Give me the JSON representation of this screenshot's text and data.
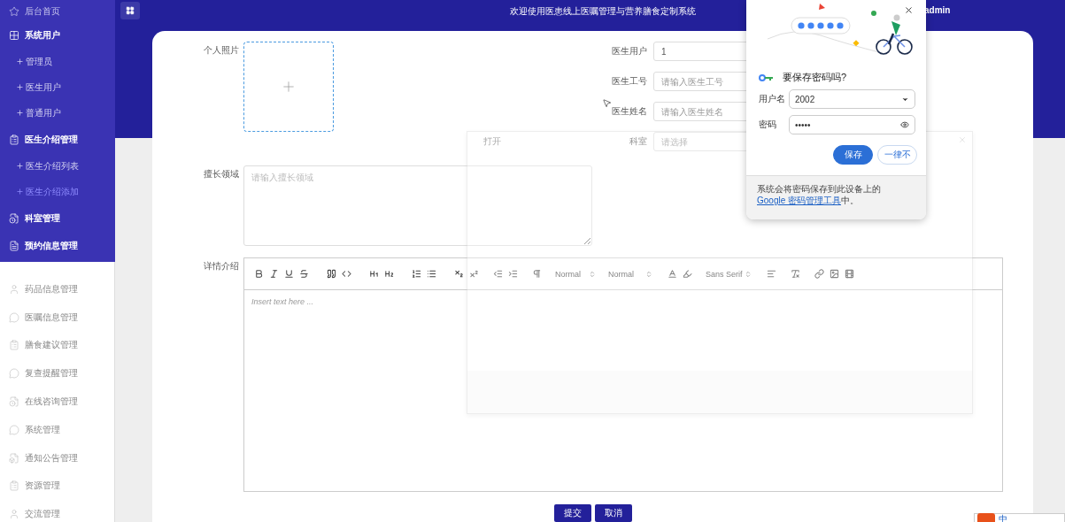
{
  "header": {
    "title": "欢迎使用医患线上医嘱管理与营养膳食定制系统",
    "user": "admin"
  },
  "sidebar": {
    "primary": [
      {
        "label": "后台首页"
      },
      {
        "label": "系统用户",
        "children": [
          {
            "label": "管理员",
            "selected": false
          },
          {
            "label": "医生用户",
            "selected": false
          },
          {
            "label": "普通用户",
            "selected": false
          }
        ]
      },
      {
        "label": "医生介绍管理",
        "children": [
          {
            "label": "医生介绍列表",
            "selected": false
          },
          {
            "label": "医生介绍添加",
            "selected": true
          }
        ]
      },
      {
        "label": "科室管理"
      },
      {
        "label": "预约信息管理"
      }
    ],
    "secondary": [
      {
        "label": "药品信息管理"
      },
      {
        "label": "医嘱信息管理"
      },
      {
        "label": "膳食建议管理"
      },
      {
        "label": "复查提醒管理"
      },
      {
        "label": "在线咨询管理"
      },
      {
        "label": "系统管理"
      },
      {
        "label": "通知公告管理"
      },
      {
        "label": "资源管理"
      },
      {
        "label": "交流管理"
      }
    ]
  },
  "form": {
    "photo_label": "个人照片",
    "fields": [
      {
        "label": "医生用户",
        "value": "1"
      },
      {
        "label": "医生工号",
        "placeholder": "请输入医生工号"
      },
      {
        "label": "医生姓名",
        "placeholder": "请输入医生姓名"
      },
      {
        "label": "科室",
        "placeholder": "请选择"
      }
    ],
    "specialty": {
      "label": "擅长领域",
      "placeholder": "请输入擅长领域"
    },
    "detail": {
      "label": "详情介绍",
      "selects": [
        "Normal",
        "Normal",
        "Sans Serif"
      ],
      "placeholder": "Insert text here ..."
    },
    "buttons": [
      "提交",
      "取消"
    ]
  },
  "ghost_dialog": {
    "title": "打开"
  },
  "password_popup": {
    "title": "要保存密码吗?",
    "username_label": "用户名",
    "username": "2002",
    "password_label": "密码",
    "password": "•••••",
    "buttons": [
      "保存",
      "一律不"
    ],
    "note_before": "系统会将密码保存到此设备上的 ",
    "note_link": "Google 密码管理工具",
    "note_after": "中。"
  },
  "ime": {
    "label": "中"
  }
}
